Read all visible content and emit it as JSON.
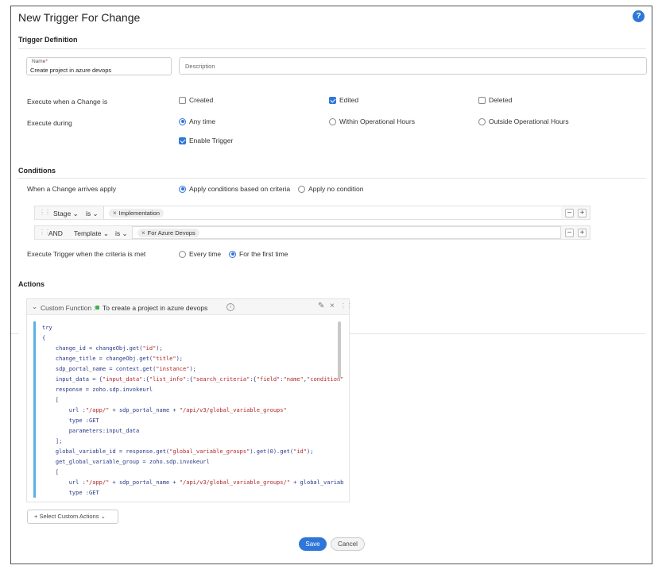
{
  "header": {
    "title": "New Trigger For Change",
    "help_glyph": "?"
  },
  "definition": {
    "heading": "Trigger Definition",
    "name_label": "Name",
    "name_value": "Create project in azure devops",
    "description_placeholder": "Description",
    "execute_when": {
      "label": "Execute when a Change is",
      "options": [
        {
          "label": "Created",
          "checked": false
        },
        {
          "label": "Edited",
          "checked": true
        },
        {
          "label": "Deleted",
          "checked": false
        }
      ]
    },
    "execute_during": {
      "label": "Execute during",
      "options": [
        {
          "label": "Any time",
          "selected": true
        },
        {
          "label": "Within Operational Hours",
          "selected": false
        },
        {
          "label": "Outside Operational Hours",
          "selected": false
        }
      ]
    },
    "enable_trigger": {
      "label": "Enable Trigger",
      "checked": true
    }
  },
  "conditions": {
    "heading": "Conditions",
    "arrives_label": "When a Change arrives apply",
    "apply_options": [
      {
        "label": "Apply conditions based on criteria",
        "selected": true
      },
      {
        "label": "Apply no condition",
        "selected": false
      }
    ],
    "rows": [
      {
        "join": "",
        "field": "Stage",
        "operator": "is",
        "value": "Implementation"
      },
      {
        "join": "AND",
        "field": "Template",
        "operator": "is",
        "value": "For Azure Devops"
      }
    ],
    "criteria_label": "Execute Trigger when the criteria is met",
    "criteria_options": [
      {
        "label": "Every time",
        "selected": false
      },
      {
        "label": "For the first time",
        "selected": true
      }
    ]
  },
  "actions": {
    "heading": "Actions",
    "card_type": "Custom Function :",
    "card_name": "To create a project in azure devops",
    "info_glyph": "i",
    "select_label": "Select Custom Actions",
    "code_lines": [
      "try",
      "{",
      "    change_id = changeObj.get(\"id\");",
      "    change_title = changeObj.get(\"title\");",
      "    sdp_portal_name = context.get(\"instance\");",
      "    input_data = {\"input_data\":{\"list_info\":{\"search_criteria\":{\"field\":\"name\",\"condition\":\"",
      "    response = zoho.sdp.invokeurl",
      "    [",
      "        url :\"/app/\" + sdp_portal_name + \"/api/v3/global_variable_groups\"",
      "        type :GET",
      "        parameters:input_data",
      "    ];",
      "    global_variable_id = response.get(\"global_variable_groups\").get(0).get(\"id\");",
      "    get_global_variable_group = zoho.sdp.invokeurl",
      "    [",
      "        url :\"/app/\" + sdp_portal_name + \"/api/v3/global_variable_groups/\" + global_variable",
      "        type :GET"
    ]
  },
  "footer": {
    "save_label": "Save",
    "cancel_label": "Cancel"
  },
  "colors": {
    "accent": "#2f76d9",
    "status_green": "#3fb24a",
    "code_bar": "#5bb0e6"
  }
}
